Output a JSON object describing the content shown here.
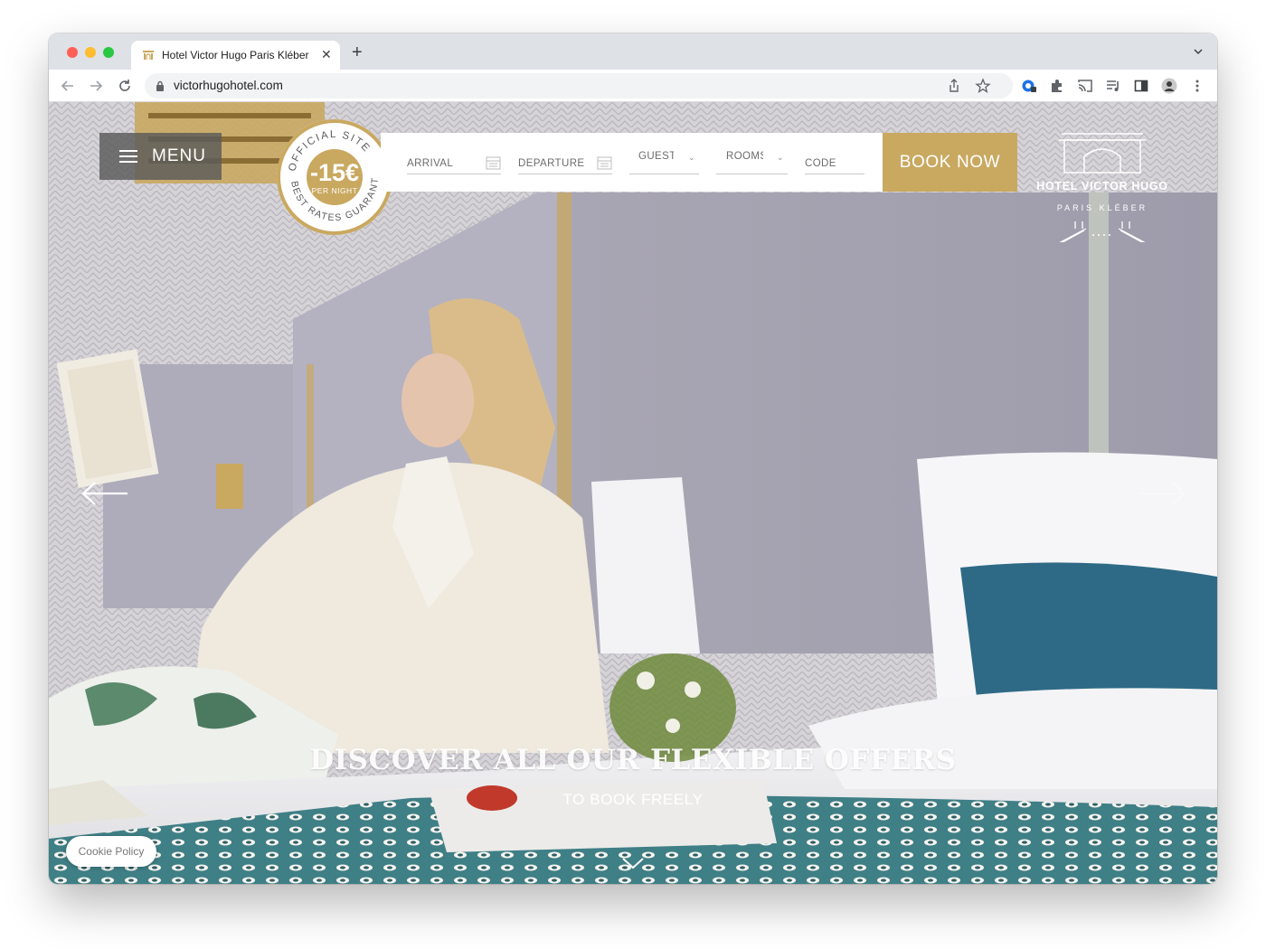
{
  "browser": {
    "tab": {
      "title": "Hotel Victor Hugo Paris Kléber",
      "close_icon": "close-icon"
    },
    "url": "victorhugohotel.com",
    "colors": {
      "tabbar": "#dee1e6",
      "traffic": [
        "#ff5f57",
        "#febc2e",
        "#28c840"
      ]
    }
  },
  "site": {
    "menu_label": "MENU",
    "badge": {
      "ring_top": "OFFICIAL SITE",
      "ring_bottom": "BEST RATES GUARANTEED",
      "discount": "-15€",
      "per": "PER NIGHT"
    },
    "booking": {
      "arrival": "ARRIVAL",
      "departure": "DEPARTURE",
      "guests": "GUESTS",
      "rooms": "ROOMS",
      "code": "CODE",
      "book_now": "BOOK NOW"
    },
    "logo": {
      "name": "HOTEL VICTOR HUGO",
      "city": "PARIS KLÉBER"
    },
    "hero": {
      "headline": "DISCOVER ALL OUR FLEXIBLE OFFERS",
      "subline": "TO BOOK FREELY"
    },
    "cookie": "Cookie Policy",
    "colors": {
      "gold": "#c9a860",
      "menu_bg": "#5a5a5a"
    }
  }
}
